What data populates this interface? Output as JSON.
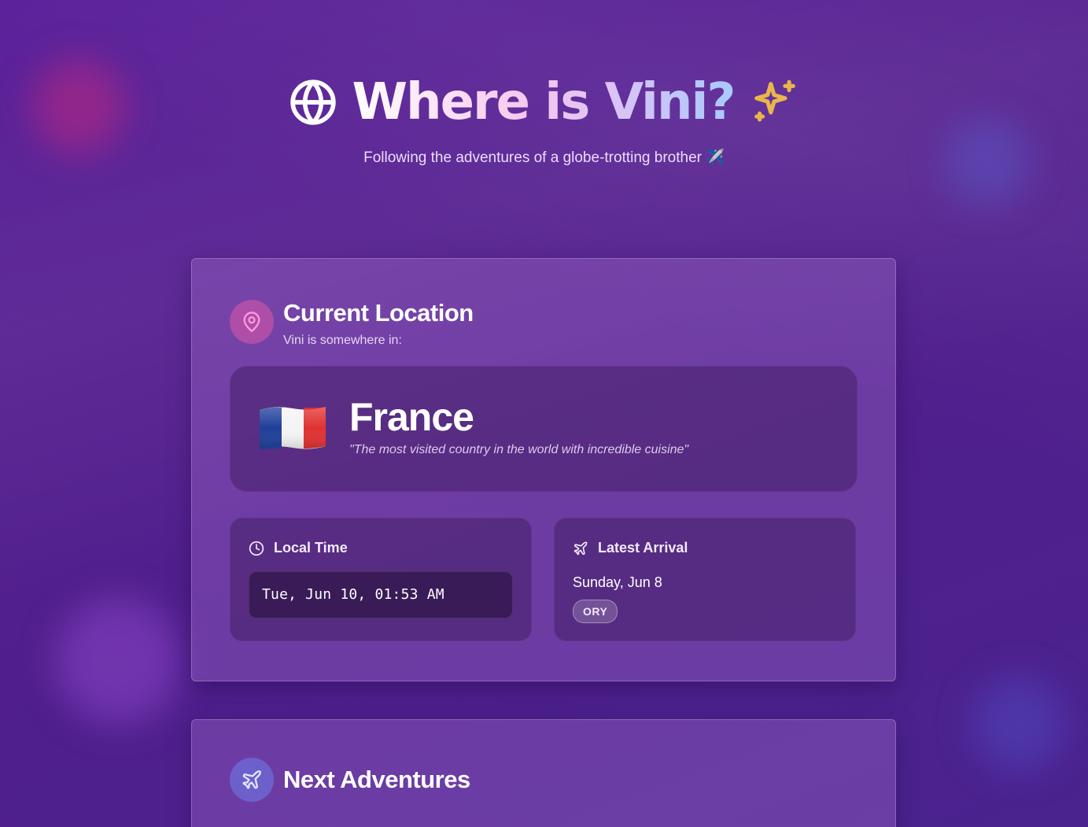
{
  "colors": {
    "background": "#55208f",
    "title_gradient_start": "#ffffff",
    "title_gradient_end": "#a8c9ff",
    "sparkle": "#e8b64c",
    "pin_circle": "#c45ab0",
    "plane_circle": "#6e78e6"
  },
  "header": {
    "title": "Where is Vini?",
    "subtitle": "Following the adventures of a globe-trotting brother ✈️",
    "icons": [
      "globe-icon",
      "sparkle-icon"
    ]
  },
  "current_location": {
    "title": "Current Location",
    "subtitle": "Vini is somewhere in:",
    "icon": "map-pin-icon",
    "country": {
      "flag": "france-flag",
      "name": "France",
      "quote": "\"The most visited country in the world with incredible cuisine\""
    },
    "local_time": {
      "label": "Local Time",
      "icon": "clock-icon",
      "value": "Tue, Jun 10, 01:53 AM"
    },
    "latest_arrival": {
      "label": "Latest Arrival",
      "icon": "plane-icon",
      "date": "Sunday, Jun 8",
      "airport": "ORY"
    }
  },
  "next_adventures": {
    "title": "Next Adventures",
    "icon": "plane-icon"
  }
}
